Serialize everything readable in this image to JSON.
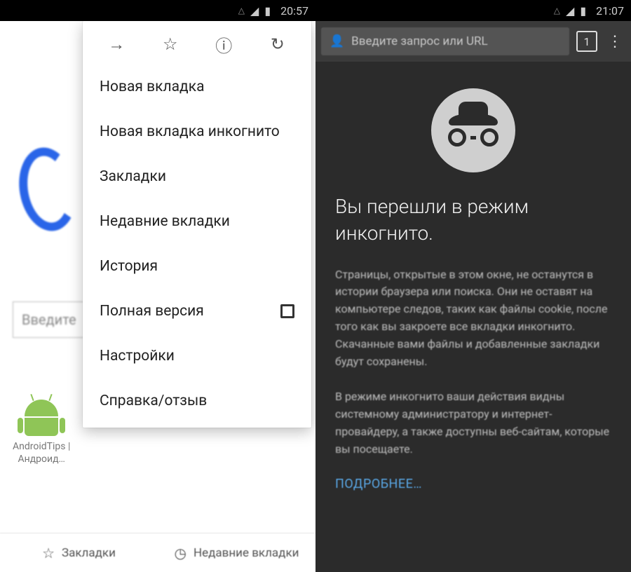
{
  "left": {
    "status": {
      "time": "20:57"
    },
    "background": {
      "search_placeholder": "Введите",
      "app_label_line1": "AndroidTips |",
      "app_label_line2": "Андроид…"
    },
    "menu": {
      "items": [
        "Новая вкладка",
        "Новая вкладка инкогнито",
        "Закладки",
        "Недавние вкладки",
        "История",
        "Полная версия",
        "Настройки",
        "Справка/отзыв"
      ]
    },
    "bottom": {
      "bookmarks": "Закладки",
      "recent": "Недавние вкладки"
    }
  },
  "right": {
    "status": {
      "time": "21:07"
    },
    "omnibar": {
      "placeholder": "Введите запрос или URL",
      "tab_count": "1"
    },
    "title": "Вы перешли в режим инкогнито.",
    "para1": "Страницы, открытые в этом окне, не останутся в истории браузера или поиска. Они не оставят на компьютере следов, таких как файлы cookie, после того как вы закроете все вкладки инкогнито. Скачанные вами файлы и добавленные закладки будут сохранены.",
    "para2": "В режиме инкогнито ваши действия видны системному администратору и интернет-провайдеру, а также доступны веб-сайтам, которые вы посещаете.",
    "learn_more": "ПОДРОБНЕЕ…"
  }
}
